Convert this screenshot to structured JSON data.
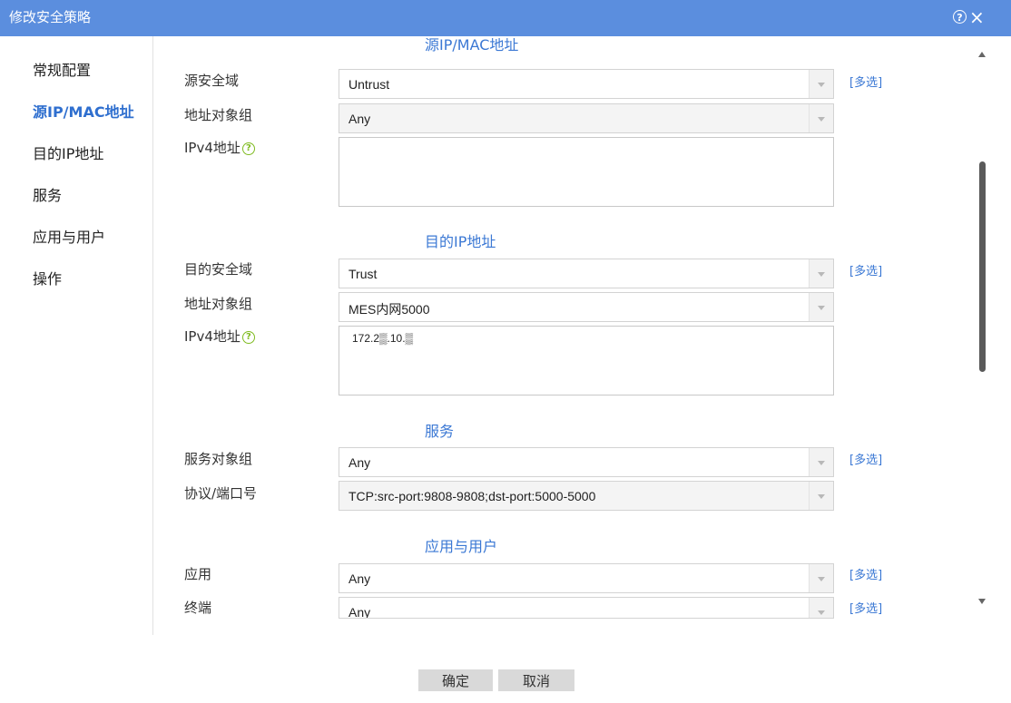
{
  "window": {
    "title": "修改安全策略",
    "help_icon_glyph": "?",
    "close_icon_glyph": "×"
  },
  "nav": {
    "items": [
      {
        "label": "常规配置",
        "active": false
      },
      {
        "label": "源IP/MAC地址",
        "active": true
      },
      {
        "label": "目的IP地址",
        "active": false
      },
      {
        "label": "服务",
        "active": false
      },
      {
        "label": "应用与用户",
        "active": false
      },
      {
        "label": "操作",
        "active": false
      }
    ]
  },
  "source": {
    "section_title": "源IP/MAC地址",
    "zone_label": "源安全域",
    "zone_value": "Untrust",
    "addr_group_label": "地址对象组",
    "addr_group_value": "Any",
    "ipv4_label": "IPv4地址",
    "ipv4_value": ""
  },
  "destination": {
    "section_title": "目的IP地址",
    "zone_label": "目的安全域",
    "zone_value": "Trust",
    "addr_group_label": "地址对象组",
    "addr_group_value": "MES内网5000",
    "ipv4_label": "IPv4地址",
    "ipv4_value": "172.2▒.10.▒"
  },
  "service": {
    "section_title": "服务",
    "group_label": "服务对象组",
    "group_value": "Any",
    "proto_label": "协议/端口号",
    "proto_value": "TCP:src-port:9808-9808;dst-port:5000-5000"
  },
  "app_user": {
    "section_title": "应用与用户",
    "app_label": "应用",
    "app_value": "Any",
    "terminal_label": "终端",
    "terminal_value": "Any"
  },
  "common": {
    "multi_select_label": "[多选]",
    "help_glyph": "?"
  },
  "footer": {
    "ok_label": "确定",
    "cancel_label": "取消"
  },
  "colors": {
    "titlebar": "#5b8ede",
    "accent": "#3b78d4",
    "help_green": "#7fbb20"
  }
}
